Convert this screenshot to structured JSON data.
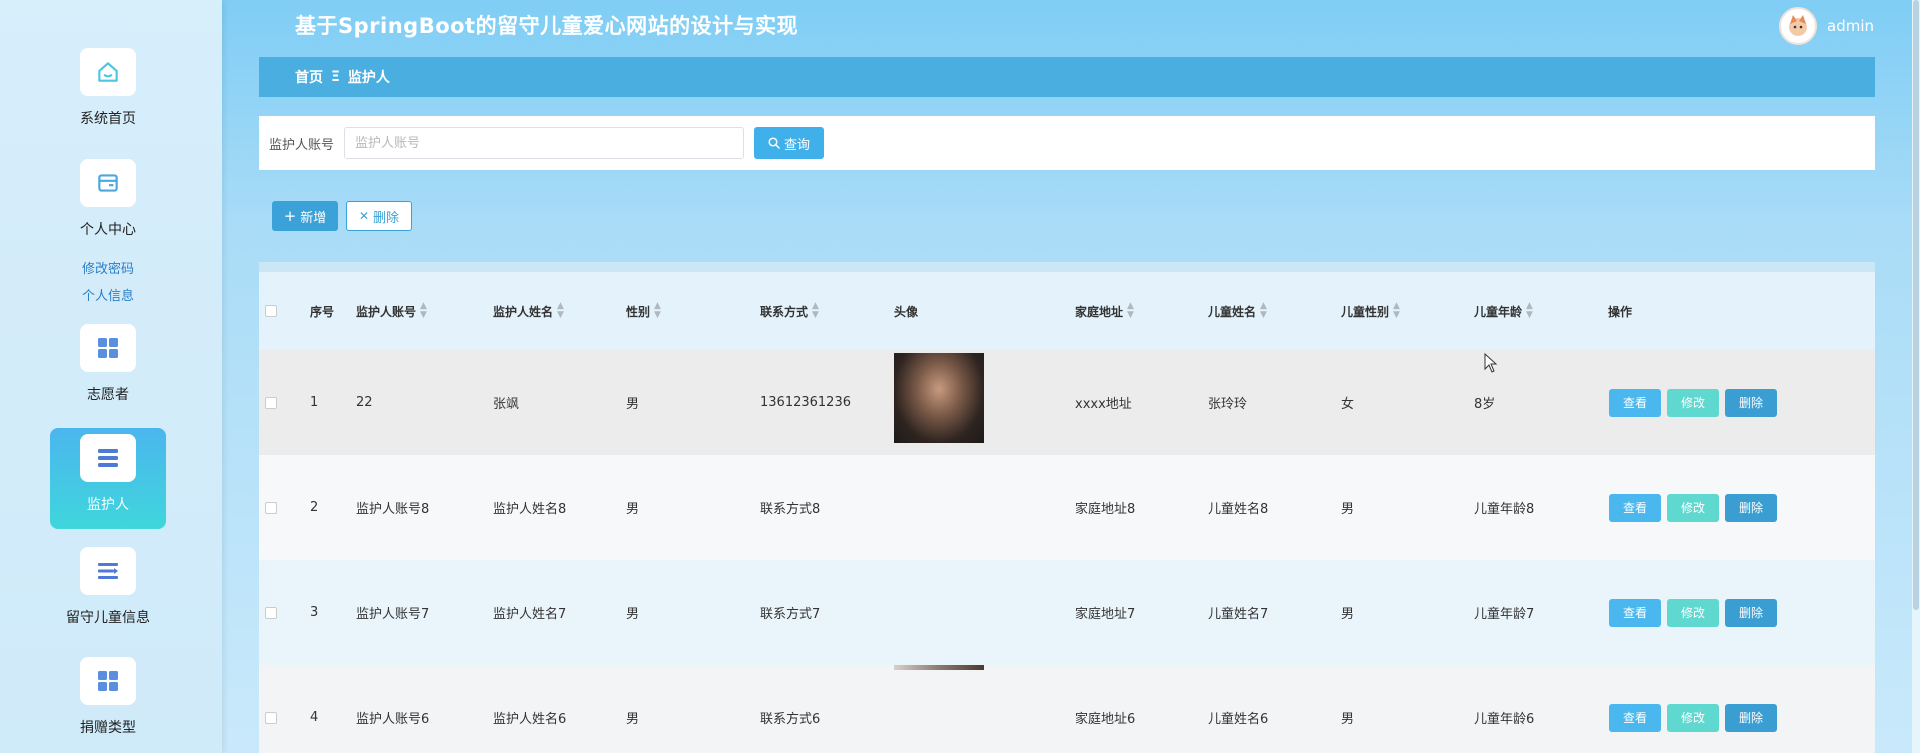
{
  "app": {
    "title": "基于SpringBoot的留守儿童爱心网站的设计与实现",
    "user": "admin"
  },
  "sidebar": {
    "items": [
      {
        "label": "系统首页",
        "icon": "home-icon"
      },
      {
        "label": "个人中心",
        "icon": "wallet-icon"
      },
      {
        "label": "志愿者",
        "icon": "grid-icon"
      },
      {
        "label": "监护人",
        "icon": "list-icon"
      },
      {
        "label": "留守儿童信息",
        "icon": "list-arrow-icon"
      },
      {
        "label": "捐赠类型",
        "icon": "grid-icon"
      }
    ],
    "sublinks": [
      "修改密码",
      "个人信息"
    ]
  },
  "breadcrumb": {
    "home": "首页",
    "separator": "Ξ",
    "current": "监护人"
  },
  "search": {
    "label": "监护人账号",
    "placeholder": "监护人账号",
    "button": "查询"
  },
  "actions": {
    "add": "新增",
    "delete": "删除"
  },
  "table": {
    "headers": [
      "序号",
      "监护人账号",
      "监护人姓名",
      "性别",
      "联系方式",
      "头像",
      "家庭地址",
      "儿童姓名",
      "儿童性别",
      "儿童年龄",
      "操作"
    ],
    "rows": [
      {
        "no": "1",
        "account": "22",
        "name": "张飒",
        "gender": "男",
        "phone": "13612361236",
        "address": "xxxx地址",
        "child_name": "张玲玲",
        "child_gender": "女",
        "child_age": "8岁"
      },
      {
        "no": "2",
        "account": "监护人账号8",
        "name": "监护人姓名8",
        "gender": "男",
        "phone": "联系方式8",
        "address": "家庭地址8",
        "child_name": "儿童姓名8",
        "child_gender": "男",
        "child_age": "儿童年龄8"
      },
      {
        "no": "3",
        "account": "监护人账号7",
        "name": "监护人姓名7",
        "gender": "男",
        "phone": "联系方式7",
        "address": "家庭地址7",
        "child_name": "儿童姓名7",
        "child_gender": "男",
        "child_age": "儿童年龄7"
      },
      {
        "no": "4",
        "account": "监护人账号6",
        "name": "监护人姓名6",
        "gender": "男",
        "phone": "联系方式6",
        "address": "家庭地址6",
        "child_name": "儿童姓名6",
        "child_gender": "男",
        "child_age": "儿童年龄6"
      }
    ],
    "ops": {
      "view": "查看",
      "edit": "修改",
      "delete": "删除"
    }
  },
  "colors": {
    "accent": "#3fb0ea",
    "breadcrumb_bg": "#4aaee0",
    "active_nav": "#4bb6ee",
    "edit_btn": "#5fd8d0"
  }
}
